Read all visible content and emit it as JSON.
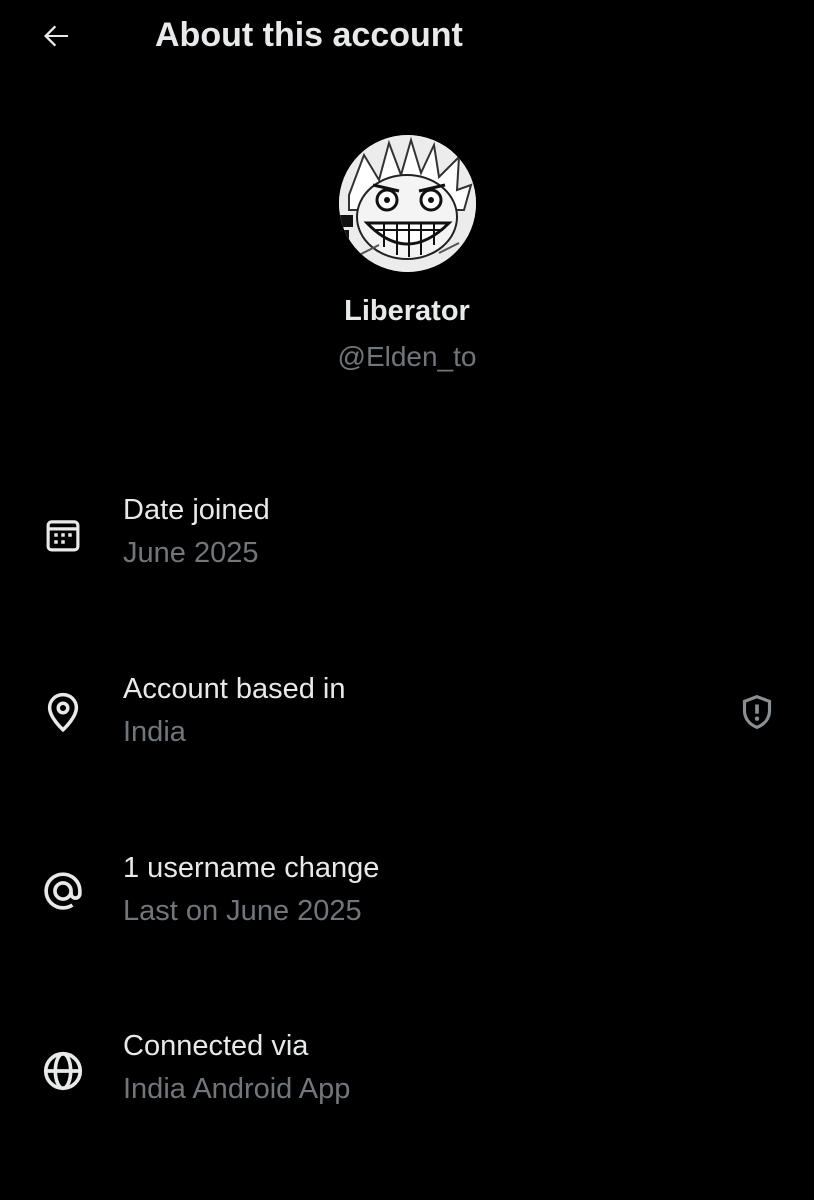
{
  "header": {
    "title": "About this account",
    "back_icon": "arrow-left-icon"
  },
  "profile": {
    "display_name": "Liberator",
    "handle": "@Elden_to",
    "avatar_icon": "avatar-illustration"
  },
  "rows": [
    {
      "icon": "calendar-icon",
      "label": "Date joined",
      "value": "June 2025"
    },
    {
      "icon": "location-pin-icon",
      "label": "Account based in",
      "value": "India",
      "trailing_icon": "shield-alert-icon"
    },
    {
      "icon": "at-sign-icon",
      "label": "1 username change",
      "value": "Last on June 2025"
    },
    {
      "icon": "globe-icon",
      "label": "Connected via",
      "value": "India Android App"
    }
  ],
  "colors": {
    "background": "#000000",
    "primary_text": "#e7e9ea",
    "secondary_text": "#71767b"
  }
}
